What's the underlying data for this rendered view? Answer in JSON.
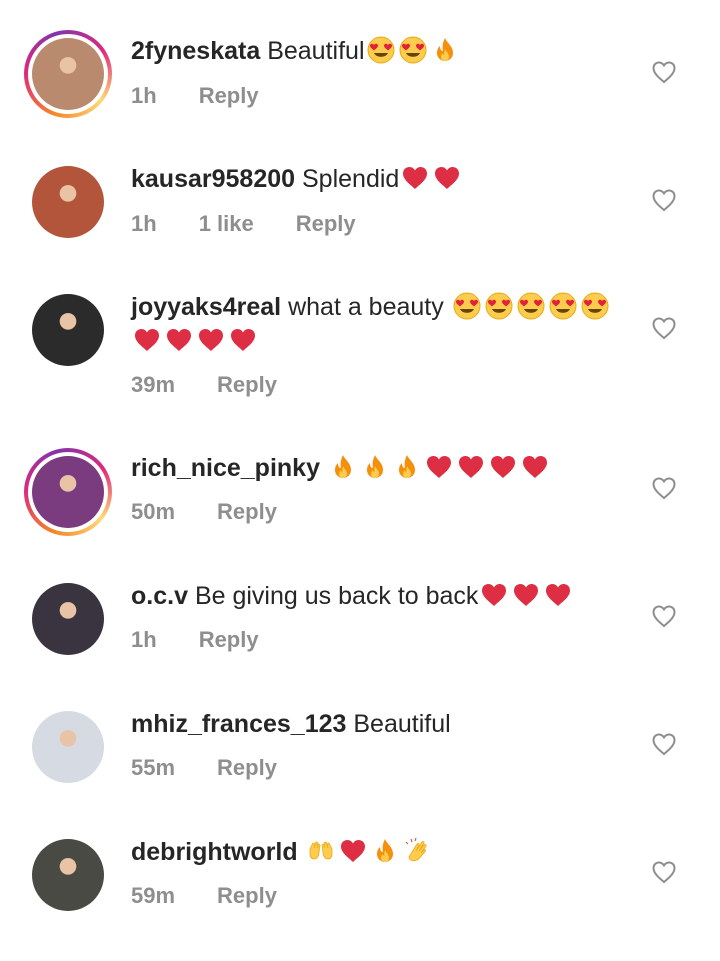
{
  "comments": [
    {
      "username": "2fyneskata",
      "text": "Beautiful",
      "emojis": [
        "heart-eyes",
        "heart-eyes",
        "fire"
      ],
      "time": "1h",
      "likes": "",
      "reply": "Reply",
      "story": true,
      "avatar_color": "#b98a6e"
    },
    {
      "username": "kausar958200",
      "text": "Splendid",
      "emojis": [
        "red-heart",
        "red-heart"
      ],
      "time": "1h",
      "likes": "1 like",
      "reply": "Reply",
      "story": false,
      "avatar_color": "#b2553a"
    },
    {
      "username": "joyyaks4real",
      "text": "what a beauty ",
      "emojis": [
        "heart-eyes",
        "heart-eyes",
        "heart-eyes",
        "heart-eyes",
        "heart-eyes",
        "red-heart",
        "red-heart",
        "red-heart",
        "red-heart"
      ],
      "time": "39m",
      "likes": "",
      "reply": "Reply",
      "story": false,
      "avatar_color": "#2b2b2b"
    },
    {
      "username": "rich_nice_pinky",
      "text": "",
      "emojis": [
        "fire",
        "fire",
        "fire",
        "red-heart",
        "red-heart",
        "red-heart",
        "red-heart"
      ],
      "time": "50m",
      "likes": "",
      "reply": "Reply",
      "story": true,
      "avatar_color": "#7a3c7e"
    },
    {
      "username": "o.c.v",
      "text": "Be giving us back to back",
      "emojis": [
        "red-heart",
        "red-heart",
        "red-heart"
      ],
      "time": "1h",
      "likes": "",
      "reply": "Reply",
      "story": false,
      "avatar_color": "#3a3340"
    },
    {
      "username": "mhiz_frances_123",
      "text": "Beautiful",
      "emojis": [],
      "time": "55m",
      "likes": "",
      "reply": "Reply",
      "story": false,
      "avatar_color": "#d6dbe3"
    },
    {
      "username": "debrightworld",
      "text": "",
      "emojis": [
        "raising-hands",
        "red-heart",
        "fire",
        "clapping-hands"
      ],
      "time": "59m",
      "likes": "",
      "reply": "Reply",
      "story": false,
      "avatar_color": "#4a4a44"
    }
  ]
}
